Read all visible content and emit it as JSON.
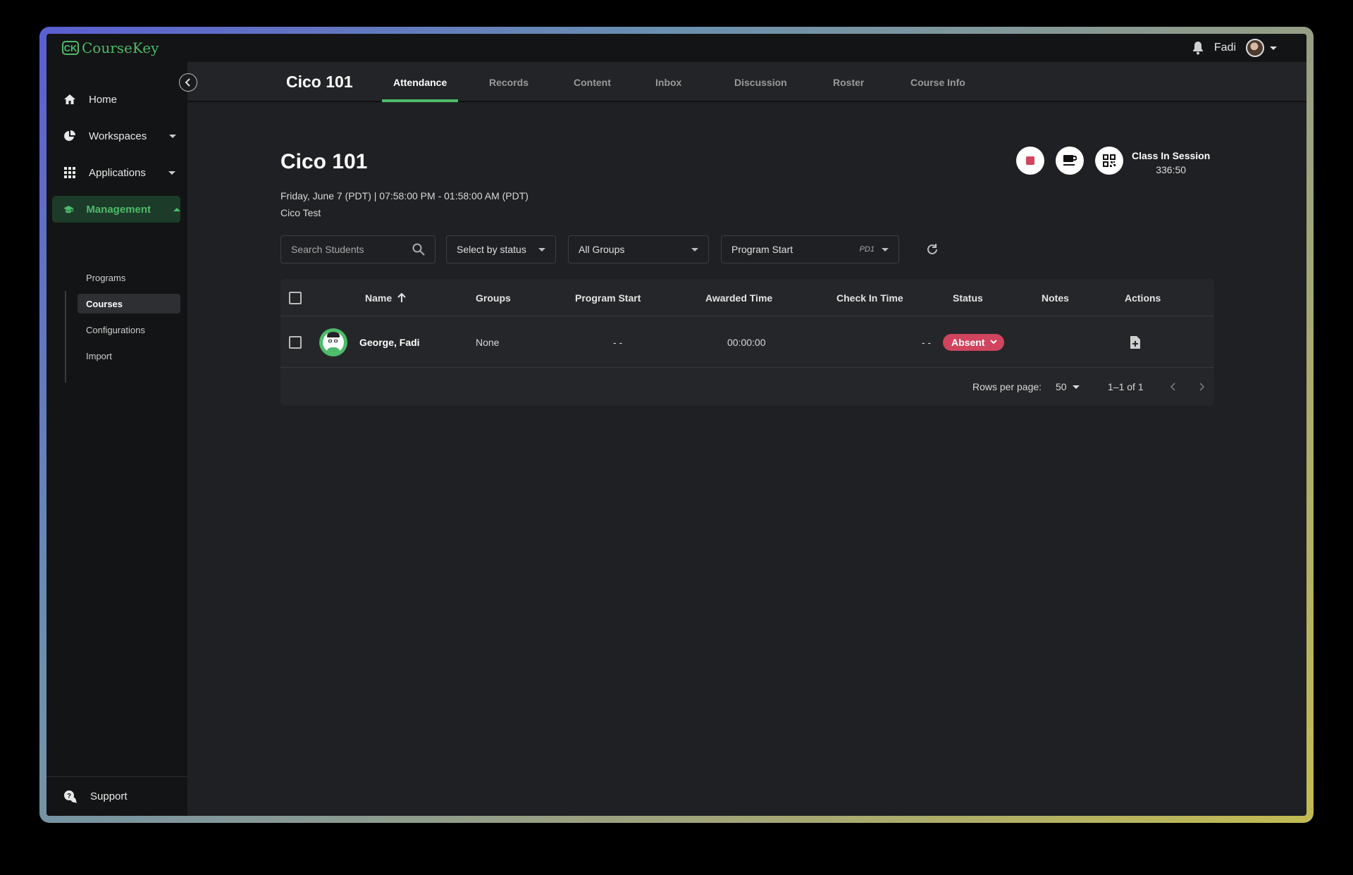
{
  "app": {
    "name": "CourseKey",
    "logo_mark": "CK"
  },
  "user": {
    "name": "Fadi"
  },
  "sidebar": {
    "items": [
      {
        "label": "Home",
        "icon": "home-icon"
      },
      {
        "label": "Workspaces",
        "icon": "pie-chart-icon"
      },
      {
        "label": "Applications",
        "icon": "grid-icon"
      },
      {
        "label": "Management",
        "icon": "graduation-cap-icon"
      }
    ],
    "subitems": [
      {
        "label": "Programs"
      },
      {
        "label": "Courses"
      },
      {
        "label": "Configurations"
      },
      {
        "label": "Import"
      }
    ],
    "support_label": "Support"
  },
  "header": {
    "course_title": "Cico 101",
    "tabs": [
      {
        "label": "Attendance"
      },
      {
        "label": "Records"
      },
      {
        "label": "Content"
      },
      {
        "label": "Inbox"
      },
      {
        "label": "Discussion"
      },
      {
        "label": "Roster"
      },
      {
        "label": "Course Info"
      }
    ]
  },
  "main": {
    "title": "Cico 101",
    "session_time": "Friday, June 7 (PDT) | 07:58:00 PM - 01:58:00 AM (PDT)",
    "session_name": "Cico Test",
    "class_status": "Class In Session",
    "timer": "336:50"
  },
  "filters": {
    "search_placeholder": "Search Students",
    "status_label": "Select by status",
    "groups_label": "All Groups",
    "program_start_label": "Program Start",
    "program_start_tag": "PD1"
  },
  "table": {
    "columns": [
      "Name",
      "Groups",
      "Program Start",
      "Awarded Time",
      "Check In Time",
      "Status",
      "Notes",
      "Actions"
    ],
    "rows": [
      {
        "name": "George, Fadi",
        "groups": "None",
        "program_start": "- -",
        "awarded_time": "00:00:00",
        "check_in_time": "- -",
        "status": "Absent",
        "notes": ""
      }
    ],
    "rows_per_page_label": "Rows per page:",
    "rows_per_page": "50",
    "pagination": "1–1 of 1"
  },
  "colors": {
    "accent": "#4dbb6a",
    "status_absent": "#d0445e",
    "background": "#1f2023",
    "sidebar": "#131415"
  }
}
